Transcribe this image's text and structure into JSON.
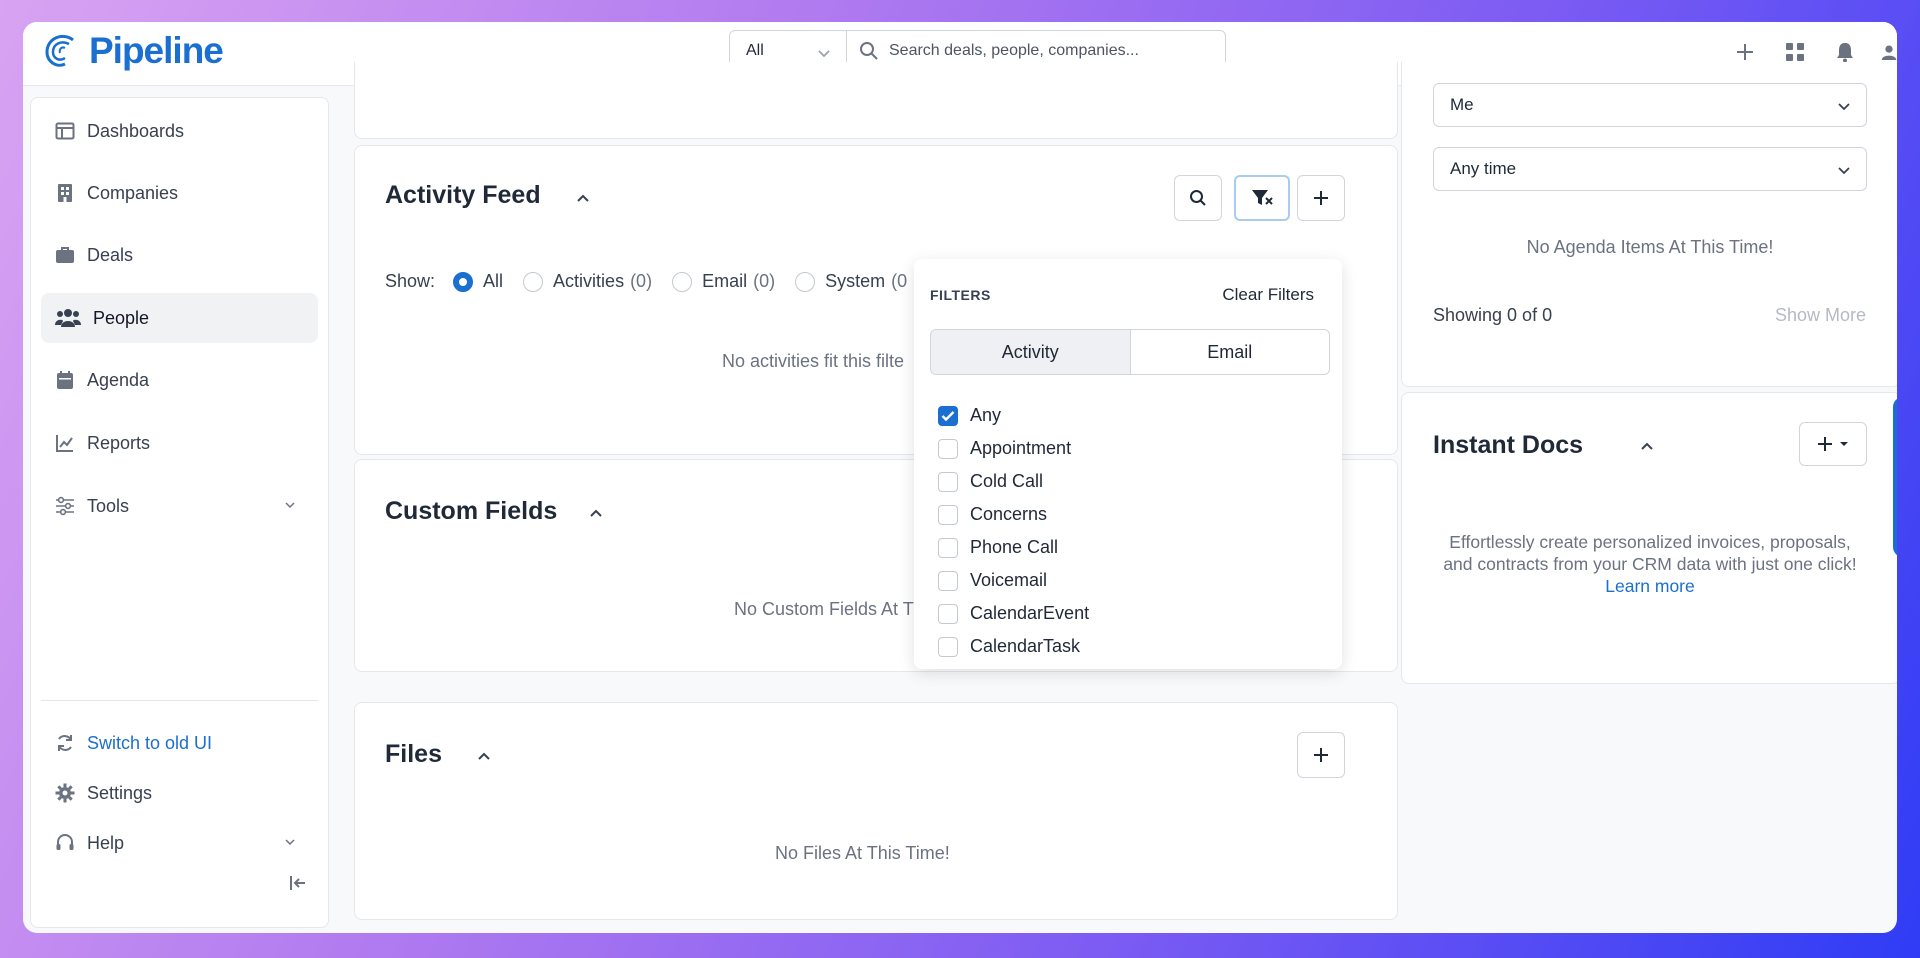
{
  "brand": {
    "name": "Pipeline",
    "color": "#1a6fd0"
  },
  "header": {
    "scope_select": "All",
    "search_placeholder": "Search deals, people, companies..."
  },
  "sidebar": {
    "items": [
      {
        "label": "Dashboards",
        "icon": "dashboard-icon"
      },
      {
        "label": "Companies",
        "icon": "building-icon"
      },
      {
        "label": "Deals",
        "icon": "briefcase-icon"
      },
      {
        "label": "People",
        "icon": "people-icon",
        "active": true
      },
      {
        "label": "Agenda",
        "icon": "calendar-icon"
      },
      {
        "label": "Reports",
        "icon": "chart-line-icon"
      },
      {
        "label": "Tools",
        "icon": "sliders-icon",
        "expandable": true
      }
    ],
    "bottom": [
      {
        "label": "Switch to old UI",
        "icon": "refresh-icon"
      },
      {
        "label": "Settings",
        "icon": "gear-icon"
      },
      {
        "label": "Help",
        "icon": "headset-icon",
        "expandable": true
      }
    ]
  },
  "activity_feed": {
    "title": "Activity Feed",
    "show_label": "Show:",
    "options": [
      {
        "label": "All",
        "count": ""
      },
      {
        "label": "Activities",
        "count": "(0)"
      },
      {
        "label": "Email",
        "count": "(0)"
      },
      {
        "label": "System",
        "count": "(0"
      }
    ],
    "empty": "No activities fit this filte"
  },
  "filters": {
    "title": "FILTERS",
    "clear": "Clear Filters",
    "tabs": [
      "Activity",
      "Email"
    ],
    "items": [
      {
        "label": "Any",
        "checked": true
      },
      {
        "label": "Appointment",
        "checked": false
      },
      {
        "label": "Cold Call",
        "checked": false
      },
      {
        "label": "Concerns",
        "checked": false
      },
      {
        "label": "Phone Call",
        "checked": false
      },
      {
        "label": "Voicemail",
        "checked": false
      },
      {
        "label": "CalendarEvent",
        "checked": false
      },
      {
        "label": "CalendarTask",
        "checked": false
      }
    ]
  },
  "custom_fields": {
    "title": "Custom Fields",
    "empty": "No Custom Fields At T"
  },
  "files": {
    "title": "Files",
    "empty": "No Files At This Time!"
  },
  "agenda": {
    "owner": "Me",
    "range": "Any time",
    "empty": "No Agenda Items At This Time!",
    "showing": "Showing 0 of 0",
    "show_more": "Show More"
  },
  "instant_docs": {
    "title": "Instant Docs",
    "text": "Effortlessly create personalized invoices, proposals, and contracts from your CRM data with just one click!",
    "link": "Learn more"
  }
}
